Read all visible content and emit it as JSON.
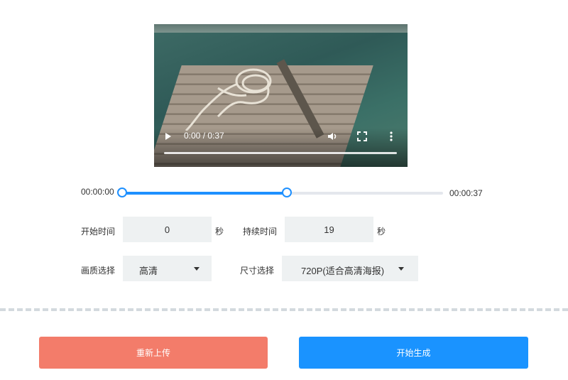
{
  "video": {
    "time_display": "0:00 / 0:37",
    "played_fraction": 0,
    "icons": [
      "play-icon",
      "volume-icon",
      "fullscreen-icon",
      "more-vertical-icon"
    ]
  },
  "range": {
    "start_label": "00:00:00",
    "end_label": "00:00:37",
    "start_fraction": 0,
    "end_fraction": 0.514
  },
  "form": {
    "start_time_label": "开始时间",
    "start_time_value": "0",
    "start_unit": "秒",
    "duration_label": "持续时间",
    "duration_value": "19",
    "duration_unit": "秒",
    "quality_label": "画质选择",
    "quality_value": "高清",
    "size_label": "尺寸选择",
    "size_value": "720P(适合高清海报)"
  },
  "buttons": {
    "reupload": "重新上传",
    "generate": "开始生成"
  },
  "colors": {
    "accent": "#1a93ff",
    "danger": "#f37c6a"
  }
}
